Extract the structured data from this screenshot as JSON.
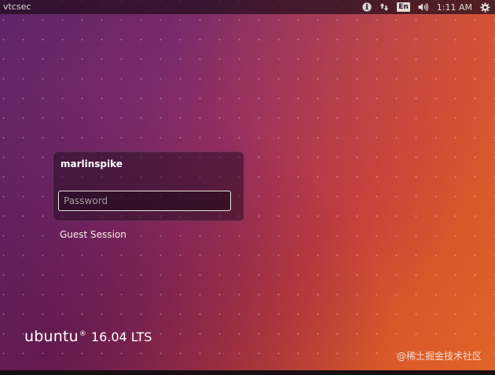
{
  "topbar": {
    "hostname": "vtcsec",
    "keyboard_layout": "En",
    "time": "1:11 AM",
    "icons": [
      "accessibility-icon",
      "network-icon",
      "keyboard-icon",
      "volume-icon",
      "power-gear-icon"
    ]
  },
  "login": {
    "username": "marlinspike",
    "password_placeholder": "Password",
    "password_value": "",
    "guest_session_label": "Guest Session"
  },
  "branding": {
    "word": "ubuntu",
    "registered": "®",
    "version": "16.04 LTS"
  },
  "watermark": {
    "text": "@稀土掘金技术社区"
  },
  "colors": {
    "background_start": "#5c2468",
    "background_end": "#e06428",
    "topbar": "#200c1c",
    "text": "#ffffff"
  }
}
